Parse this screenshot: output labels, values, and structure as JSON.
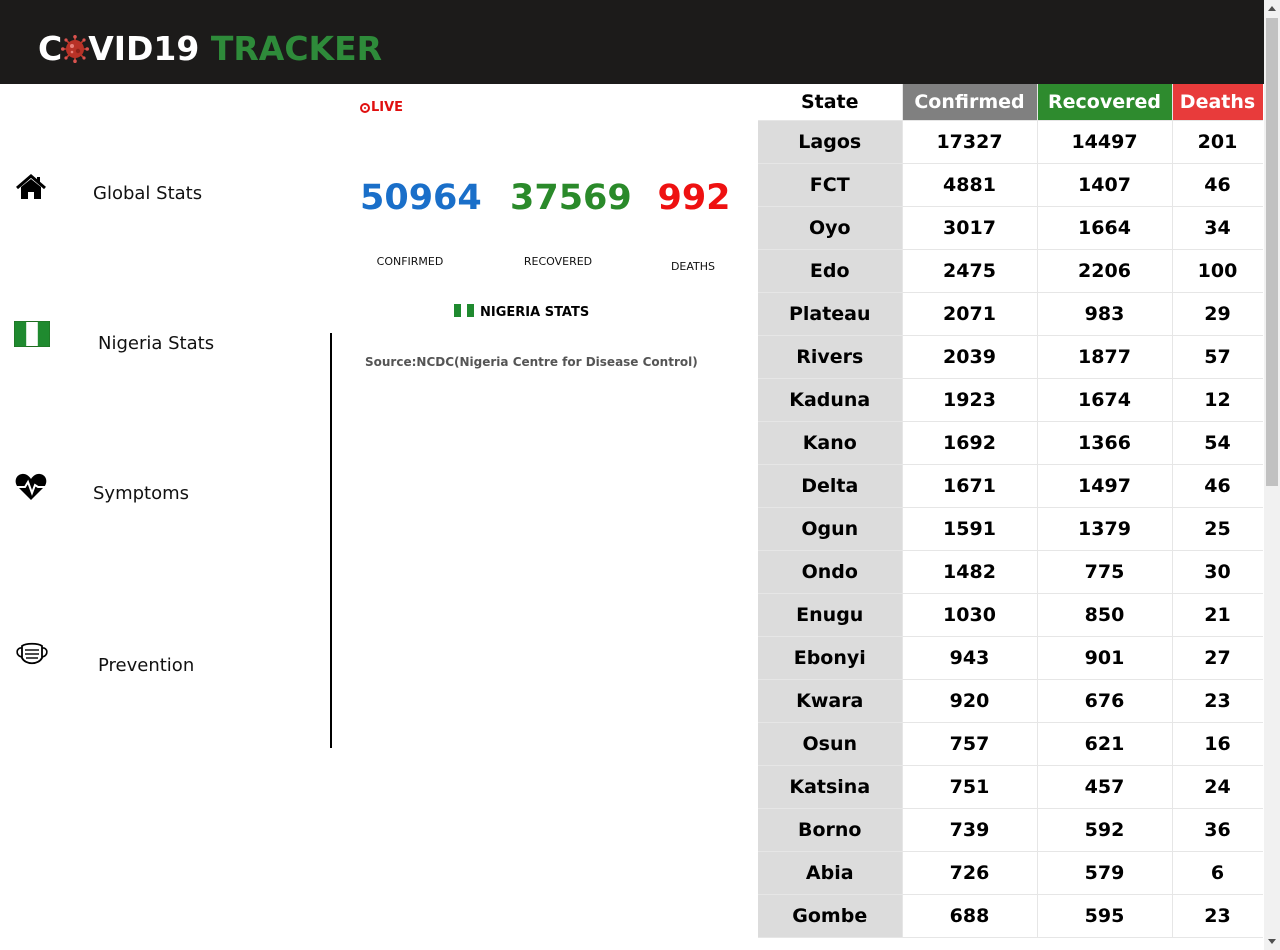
{
  "app": {
    "logo_c": "C",
    "logo_mid": "VID19",
    "logo_tracker": "TRACKER"
  },
  "sidebar": {
    "items": [
      {
        "label": "Global Stats",
        "icon": "home-icon"
      },
      {
        "label": "Nigeria Stats",
        "icon": "nigeria-flag-icon"
      },
      {
        "label": "Symptoms",
        "icon": "heartbeat-icon"
      },
      {
        "label": "Prevention",
        "icon": "face-mask-icon"
      }
    ]
  },
  "main": {
    "live_label": "LIVE",
    "confirmed": "50964",
    "recovered": "37569",
    "deaths": "992",
    "confirmed_label": "CONFIRMED",
    "recovered_label": "RECOVERED",
    "deaths_label": "DEATHS",
    "nigeria_stats_label": "NIGERIA STATS",
    "source": "Source:NCDC(Nigeria Centre for Disease Control)"
  },
  "colors": {
    "header_bg": "#1c1b1a",
    "tracker_green": "#2e8b3a",
    "confirmed_blue": "#1a6fc9",
    "recovered_green": "#2a8a2a",
    "deaths_red": "#ee1111",
    "col_confirmed": "#808080",
    "col_recovered": "#2e8b2e",
    "col_deaths": "#e83b3b"
  },
  "table": {
    "headers": [
      "State",
      "Confirmed",
      "Recovered",
      "Deaths"
    ],
    "rows": [
      [
        "Lagos",
        "17327",
        "14497",
        "201"
      ],
      [
        "FCT",
        "4881",
        "1407",
        "46"
      ],
      [
        "Oyo",
        "3017",
        "1664",
        "34"
      ],
      [
        "Edo",
        "2475",
        "2206",
        "100"
      ],
      [
        "Plateau",
        "2071",
        "983",
        "29"
      ],
      [
        "Rivers",
        "2039",
        "1877",
        "57"
      ],
      [
        "Kaduna",
        "1923",
        "1674",
        "12"
      ],
      [
        "Kano",
        "1692",
        "1366",
        "54"
      ],
      [
        "Delta",
        "1671",
        "1497",
        "46"
      ],
      [
        "Ogun",
        "1591",
        "1379",
        "25"
      ],
      [
        "Ondo",
        "1482",
        "775",
        "30"
      ],
      [
        "Enugu",
        "1030",
        "850",
        "21"
      ],
      [
        "Ebonyi",
        "943",
        "901",
        "27"
      ],
      [
        "Kwara",
        "920",
        "676",
        "23"
      ],
      [
        "Osun",
        "757",
        "621",
        "16"
      ],
      [
        "Katsina",
        "751",
        "457",
        "24"
      ],
      [
        "Borno",
        "739",
        "592",
        "36"
      ],
      [
        "Abia",
        "726",
        "579",
        "6"
      ],
      [
        "Gombe",
        "688",
        "595",
        "23"
      ]
    ]
  }
}
